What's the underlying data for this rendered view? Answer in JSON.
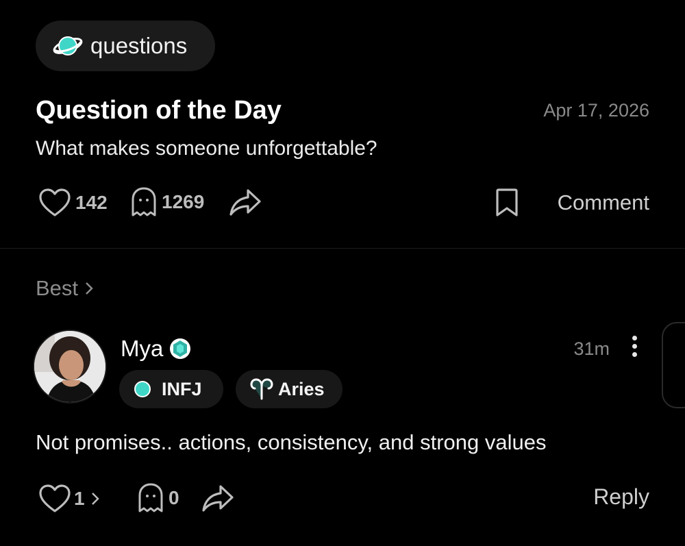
{
  "topic_chip": {
    "label": "questions",
    "icon": "planet-icon",
    "accent": "#3fd6c8"
  },
  "question": {
    "title": "Question of the Day",
    "date": "Apr 17, 2026",
    "text": "What makes someone unforgettable?",
    "likes": "142",
    "ghost_count": "1269",
    "comment_label": "Comment"
  },
  "best_label": "Best",
  "comment": {
    "username": "Mya",
    "badge_icon": "gem-badge-icon",
    "time": "31m",
    "tags": {
      "mbti": "INFJ",
      "zodiac": "Aries"
    },
    "text": "Not promises.. actions, consistency, and strong values",
    "likes": "1",
    "ghost_count": "0",
    "reply_label": "Reply"
  },
  "colors": {
    "background": "#000000",
    "accent": "#3fd6c8",
    "muted": "#8a8a8a"
  }
}
